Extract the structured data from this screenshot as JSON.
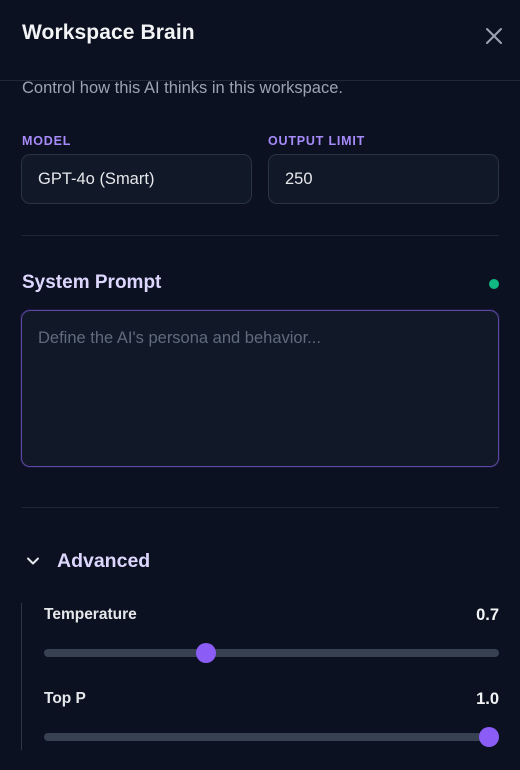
{
  "panel": {
    "title": "Workspace Brain",
    "close_icon": "close-icon",
    "subtitle": "Control how this AI thinks in this workspace."
  },
  "model": {
    "label": "MODEL",
    "value": "GPT-4o (Smart)"
  },
  "output_limit": {
    "label": "OUTPUT LIMIT",
    "value": "250"
  },
  "system_prompt": {
    "heading": "System Prompt",
    "status": "active",
    "placeholder": "Define the AI's persona and behavior..."
  },
  "advanced": {
    "label": "Advanced",
    "expanded": true,
    "chevron_icon": "chevron-down-icon",
    "sliders": [
      {
        "label": "Temperature",
        "value": "0.7",
        "fraction": 0.35
      },
      {
        "label": "Top P",
        "value": "1.0",
        "fraction": 1.0
      }
    ]
  },
  "colors": {
    "background": "#0b1120",
    "accent": "#8b5cf6",
    "label_accent": "#a78bfa",
    "status_dot": "#10b981"
  }
}
